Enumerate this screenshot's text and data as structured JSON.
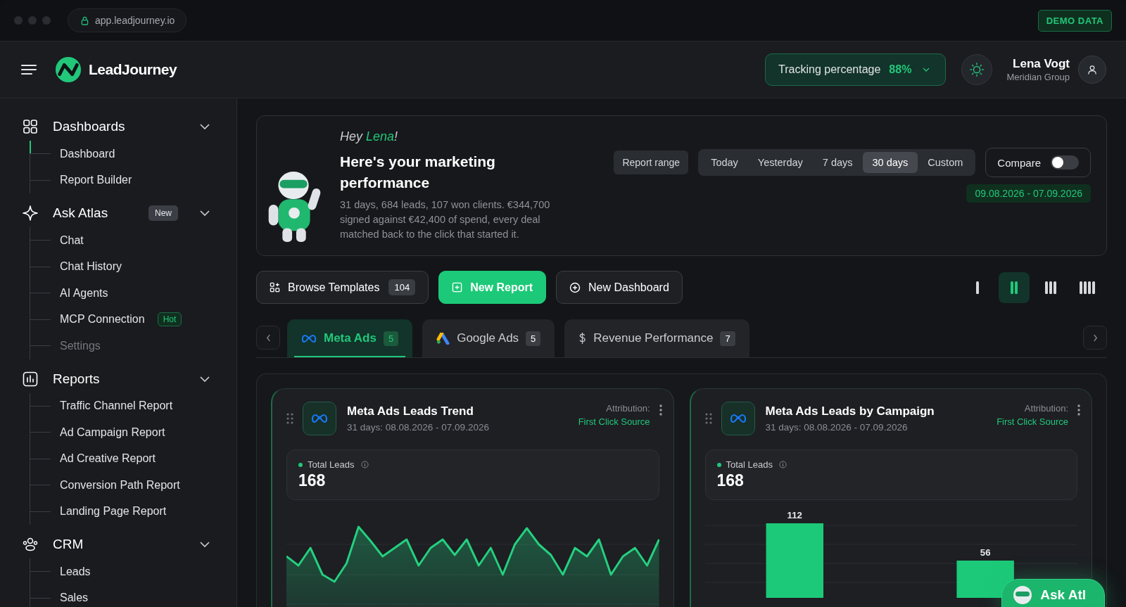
{
  "browser": {
    "address": "app.leadjourney.io",
    "badge": "DEMO DATA"
  },
  "header": {
    "app_name": "LeadJourney",
    "tracking": {
      "label": "Tracking percentage",
      "value": "88%"
    },
    "user": {
      "name": "Lena Vogt",
      "company": "Meridian Group"
    }
  },
  "sidebar": {
    "sections": [
      {
        "label": "Dashboards",
        "expanded": true,
        "children": [
          {
            "label": "Dashboard",
            "selected": true,
            "disabled": false
          },
          {
            "label": "Report Builder",
            "selected": false,
            "disabled": false
          }
        ]
      },
      {
        "label": "Ask Atlas",
        "expanded": true,
        "badge": {
          "text": "New",
          "kind": "neutral"
        },
        "children": [
          {
            "label": "Chat",
            "selected": false,
            "disabled": false
          },
          {
            "label": "Chat History",
            "selected": false,
            "disabled": false
          },
          {
            "label": "AI Agents",
            "selected": false,
            "disabled": false
          },
          {
            "label": "MCP Connection",
            "selected": false,
            "disabled": false,
            "badge": {
              "text": "Hot",
              "kind": "accent"
            }
          },
          {
            "label": "Settings",
            "selected": false,
            "disabled": true
          }
        ]
      },
      {
        "label": "Reports",
        "expanded": true,
        "children": [
          {
            "label": "Traffic Channel Report",
            "selected": false,
            "disabled": false
          },
          {
            "label": "Ad Campaign Report",
            "selected": false,
            "disabled": false
          },
          {
            "label": "Ad Creative Report",
            "selected": false,
            "disabled": false
          },
          {
            "label": "Conversion Path Report",
            "selected": false,
            "disabled": false
          },
          {
            "label": "Landing Page Report",
            "selected": false,
            "disabled": false
          }
        ]
      },
      {
        "label": "CRM",
        "expanded": true,
        "children": [
          {
            "label": "Leads",
            "selected": false,
            "disabled": false
          },
          {
            "label": "Sales",
            "selected": false,
            "disabled": false
          }
        ]
      }
    ]
  },
  "hero": {
    "greeting": "Hey **Lena**!",
    "title": "Here's your marketing performance",
    "summary": "31 days, 684 leads, 107 won clients. €344,700 signed against €42,400 of spend, every deal matched back to the click that started it.",
    "range_label": "Report range",
    "ranges": [
      {
        "label": "Today",
        "selected": false
      },
      {
        "label": "Yesterday",
        "selected": false
      },
      {
        "label": "7 days",
        "selected": false
      },
      {
        "label": "30 days",
        "selected": true
      },
      {
        "label": "Custom",
        "selected": false
      }
    ],
    "compare": {
      "label": "Compare",
      "on": false
    },
    "date_range": "09.08.2026 - 07.09.2026"
  },
  "actions": {
    "browse": {
      "label": "Browse Templates",
      "count": "104"
    },
    "new_report": "New Report",
    "new_dashboard": "New Dashboard"
  },
  "layout_options": [
    {
      "selected": false
    },
    {
      "selected": true
    },
    {
      "selected": false
    },
    {
      "selected": false
    }
  ],
  "tabs": [
    {
      "label": "Meta Ads",
      "count": "5",
      "selected": true
    },
    {
      "label": "Google Ads",
      "count": "5",
      "selected": false
    },
    {
      "label": "Revenue Performance",
      "count": "7",
      "selected": false
    }
  ],
  "cards": [
    {
      "kind": "trend",
      "title": "Meta Ads Leads Trend",
      "subtitle": "31 days: 08.08.2026 - 07.09.2026",
      "attribution_label": "Attribution:",
      "attribution": "First Click Source",
      "metric_label": "Total Leads",
      "metric_value": "168"
    },
    {
      "kind": "bar",
      "title": "Meta Ads Leads by Campaign",
      "subtitle": "31 days: 08.08.2026 - 07.09.2026",
      "attribution_label": "Attribution:",
      "attribution": "First Click Source",
      "metric_label": "Total Leads",
      "metric_value": "168",
      "chart_data": {
        "type": "bar",
        "categories": [
          null,
          null
        ],
        "series": [
          {
            "name": null,
            "color": "#1cc978",
            "values": [
              112,
              56
            ]
          }
        ],
        "data_labels": true
      }
    }
  ],
  "assistant_button": "Ask Atl"
}
